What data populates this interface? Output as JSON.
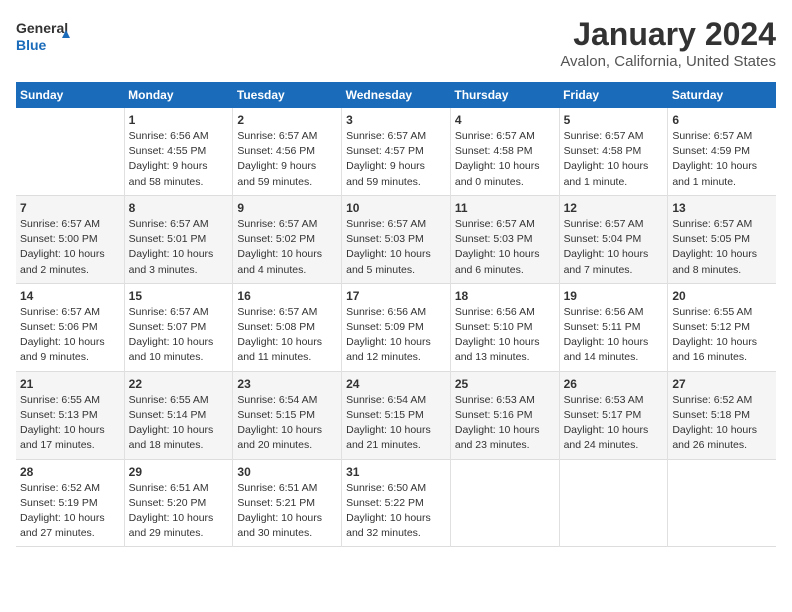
{
  "header": {
    "logo_line1": "General",
    "logo_line2": "Blue",
    "title": "January 2024",
    "subtitle": "Avalon, California, United States"
  },
  "days_of_week": [
    "Sunday",
    "Monday",
    "Tuesday",
    "Wednesday",
    "Thursday",
    "Friday",
    "Saturday"
  ],
  "weeks": [
    [
      {
        "day": "",
        "info": ""
      },
      {
        "day": "1",
        "info": "Sunrise: 6:56 AM\nSunset: 4:55 PM\nDaylight: 9 hours\nand 58 minutes."
      },
      {
        "day": "2",
        "info": "Sunrise: 6:57 AM\nSunset: 4:56 PM\nDaylight: 9 hours\nand 59 minutes."
      },
      {
        "day": "3",
        "info": "Sunrise: 6:57 AM\nSunset: 4:57 PM\nDaylight: 9 hours\nand 59 minutes."
      },
      {
        "day": "4",
        "info": "Sunrise: 6:57 AM\nSunset: 4:58 PM\nDaylight: 10 hours\nand 0 minutes."
      },
      {
        "day": "5",
        "info": "Sunrise: 6:57 AM\nSunset: 4:58 PM\nDaylight: 10 hours\nand 1 minute."
      },
      {
        "day": "6",
        "info": "Sunrise: 6:57 AM\nSunset: 4:59 PM\nDaylight: 10 hours\nand 1 minute."
      }
    ],
    [
      {
        "day": "7",
        "info": "Sunrise: 6:57 AM\nSunset: 5:00 PM\nDaylight: 10 hours\nand 2 minutes."
      },
      {
        "day": "8",
        "info": "Sunrise: 6:57 AM\nSunset: 5:01 PM\nDaylight: 10 hours\nand 3 minutes."
      },
      {
        "day": "9",
        "info": "Sunrise: 6:57 AM\nSunset: 5:02 PM\nDaylight: 10 hours\nand 4 minutes."
      },
      {
        "day": "10",
        "info": "Sunrise: 6:57 AM\nSunset: 5:03 PM\nDaylight: 10 hours\nand 5 minutes."
      },
      {
        "day": "11",
        "info": "Sunrise: 6:57 AM\nSunset: 5:03 PM\nDaylight: 10 hours\nand 6 minutes."
      },
      {
        "day": "12",
        "info": "Sunrise: 6:57 AM\nSunset: 5:04 PM\nDaylight: 10 hours\nand 7 minutes."
      },
      {
        "day": "13",
        "info": "Sunrise: 6:57 AM\nSunset: 5:05 PM\nDaylight: 10 hours\nand 8 minutes."
      }
    ],
    [
      {
        "day": "14",
        "info": "Sunrise: 6:57 AM\nSunset: 5:06 PM\nDaylight: 10 hours\nand 9 minutes."
      },
      {
        "day": "15",
        "info": "Sunrise: 6:57 AM\nSunset: 5:07 PM\nDaylight: 10 hours\nand 10 minutes."
      },
      {
        "day": "16",
        "info": "Sunrise: 6:57 AM\nSunset: 5:08 PM\nDaylight: 10 hours\nand 11 minutes."
      },
      {
        "day": "17",
        "info": "Sunrise: 6:56 AM\nSunset: 5:09 PM\nDaylight: 10 hours\nand 12 minutes."
      },
      {
        "day": "18",
        "info": "Sunrise: 6:56 AM\nSunset: 5:10 PM\nDaylight: 10 hours\nand 13 minutes."
      },
      {
        "day": "19",
        "info": "Sunrise: 6:56 AM\nSunset: 5:11 PM\nDaylight: 10 hours\nand 14 minutes."
      },
      {
        "day": "20",
        "info": "Sunrise: 6:55 AM\nSunset: 5:12 PM\nDaylight: 10 hours\nand 16 minutes."
      }
    ],
    [
      {
        "day": "21",
        "info": "Sunrise: 6:55 AM\nSunset: 5:13 PM\nDaylight: 10 hours\nand 17 minutes."
      },
      {
        "day": "22",
        "info": "Sunrise: 6:55 AM\nSunset: 5:14 PM\nDaylight: 10 hours\nand 18 minutes."
      },
      {
        "day": "23",
        "info": "Sunrise: 6:54 AM\nSunset: 5:15 PM\nDaylight: 10 hours\nand 20 minutes."
      },
      {
        "day": "24",
        "info": "Sunrise: 6:54 AM\nSunset: 5:15 PM\nDaylight: 10 hours\nand 21 minutes."
      },
      {
        "day": "25",
        "info": "Sunrise: 6:53 AM\nSunset: 5:16 PM\nDaylight: 10 hours\nand 23 minutes."
      },
      {
        "day": "26",
        "info": "Sunrise: 6:53 AM\nSunset: 5:17 PM\nDaylight: 10 hours\nand 24 minutes."
      },
      {
        "day": "27",
        "info": "Sunrise: 6:52 AM\nSunset: 5:18 PM\nDaylight: 10 hours\nand 26 minutes."
      }
    ],
    [
      {
        "day": "28",
        "info": "Sunrise: 6:52 AM\nSunset: 5:19 PM\nDaylight: 10 hours\nand 27 minutes."
      },
      {
        "day": "29",
        "info": "Sunrise: 6:51 AM\nSunset: 5:20 PM\nDaylight: 10 hours\nand 29 minutes."
      },
      {
        "day": "30",
        "info": "Sunrise: 6:51 AM\nSunset: 5:21 PM\nDaylight: 10 hours\nand 30 minutes."
      },
      {
        "day": "31",
        "info": "Sunrise: 6:50 AM\nSunset: 5:22 PM\nDaylight: 10 hours\nand 32 minutes."
      },
      {
        "day": "",
        "info": ""
      },
      {
        "day": "",
        "info": ""
      },
      {
        "day": "",
        "info": ""
      }
    ]
  ]
}
